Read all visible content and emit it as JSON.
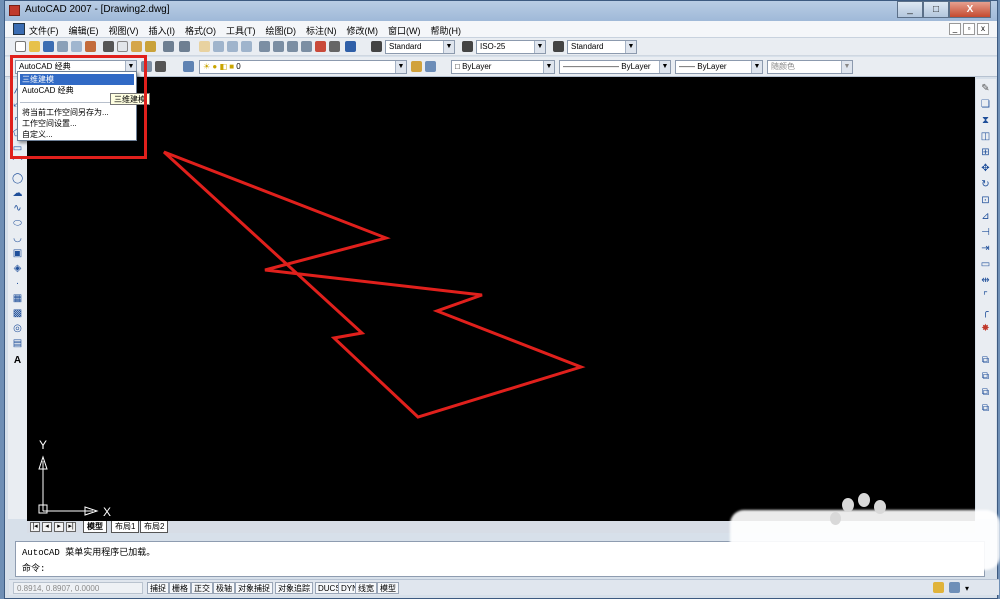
{
  "window": {
    "title": "AutoCAD 2007 - [Drawing2.dwg]",
    "min": "_",
    "max": "□",
    "close": "X"
  },
  "menubar": {
    "items": [
      "文件(F)",
      "编辑(E)",
      "视图(V)",
      "插入(I)",
      "格式(O)",
      "工具(T)",
      "绘图(D)",
      "标注(N)",
      "修改(M)",
      "窗口(W)",
      "帮助(H)"
    ],
    "mdi_min": "_",
    "mdi_restore": "▫",
    "mdi_close": "x"
  },
  "toolbar1": {
    "text_style": "Standard",
    "dim_style": "ISO-25",
    "table_style": "Standard"
  },
  "toolbar2": {
    "workspace": "AutoCAD 经典",
    "layer": "0",
    "color": "ByLayer",
    "linetype": "ByLayer",
    "lineweight": "ByLayer",
    "plotstyle": "随颜色"
  },
  "workspace_dropdown": {
    "items": [
      "三维建模",
      "AutoCAD 经典",
      "将当前工作空间另存为...",
      "工作空间设置...",
      "自定义..."
    ],
    "tooltip": "三维建模"
  },
  "axes": {
    "y": "Y",
    "x": "X"
  },
  "tabs": {
    "model": "模型",
    "layout1": "布局1",
    "layout2": "布局2"
  },
  "command": {
    "line1": "AutoCAD 菜单实用程序已加载。",
    "prompt": "命令:"
  },
  "status": {
    "coords": "0.8914,  0.8907,  0.0000",
    "buttons": [
      "捕捉",
      "栅格",
      "正交",
      "极轴",
      "对象捕捉",
      "对象追踪",
      "DUCS",
      "DYN",
      "线宽",
      "模型"
    ]
  },
  "colors": {
    "canvas": "#000000",
    "shape_stroke": "#e0201c",
    "highlight_box": "#e0201c",
    "selection": "#316ac5"
  },
  "icons": [
    "new-icon",
    "open-icon",
    "save-icon",
    "print-icon",
    "undo-icon",
    "redo-icon",
    "pan-icon",
    "zoom-icon",
    "help-icon",
    "line-icon",
    "circle-icon",
    "arc-icon",
    "erase-icon",
    "copy-icon",
    "mirror-icon",
    "move-icon",
    "rotate-icon"
  ]
}
